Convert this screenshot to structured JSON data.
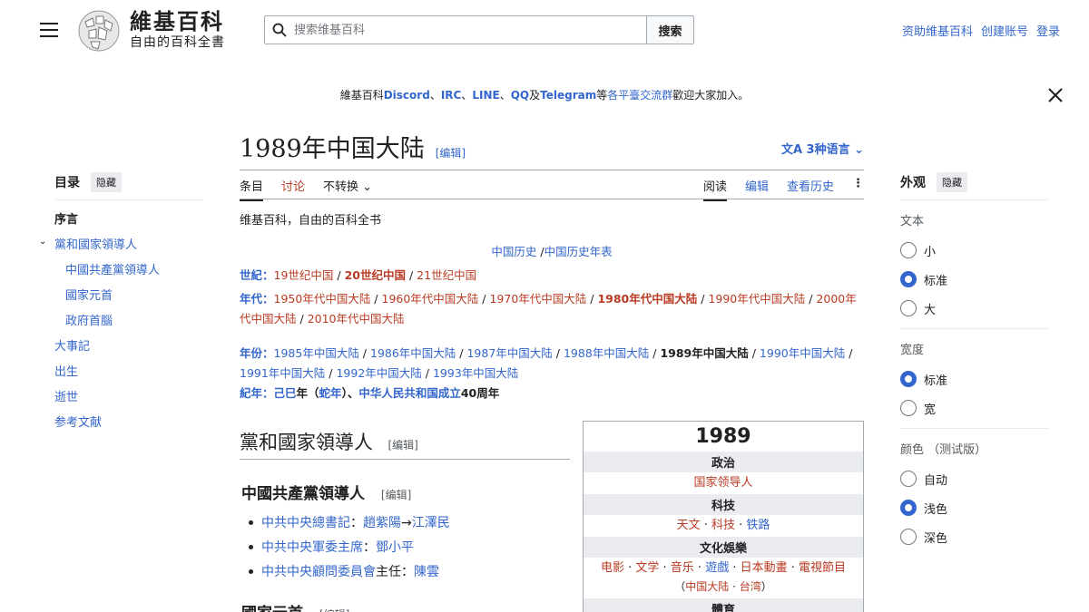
{
  "header": {
    "wordmark_title": "維基百科",
    "wordmark_tagline": "自由的百科全書",
    "search_placeholder": "搜索维基百科",
    "search_button": "搜索",
    "user_links": [
      "资助维基百科",
      "创建账号",
      "登录"
    ]
  },
  "banner": {
    "pre": "維基百科",
    "discord": "Discord",
    "sep1": "、",
    "irc": "IRC",
    "sep2": "、",
    "line": "LINE",
    "sep3": "、",
    "qq": "QQ",
    "and": "及",
    "telegram": "Telegram",
    "mid": "等",
    "platforms": "各平臺交流群",
    "post": "歡迎大家加入。"
  },
  "toc": {
    "title": "目录",
    "hide": "隐藏",
    "items": [
      {
        "label": "序言"
      },
      {
        "label": "黨和國家領導人"
      },
      {
        "label": "中國共產黨領導人"
      },
      {
        "label": "國家元首"
      },
      {
        "label": "政府首腦"
      },
      {
        "label": "大事記"
      },
      {
        "label": "出生"
      },
      {
        "label": "逝世"
      },
      {
        "label": "参考文献"
      }
    ]
  },
  "article": {
    "title": "1989年中国大陆",
    "edit": "[编辑]",
    "lang": "3种语言",
    "tabs_left": [
      "条目",
      "讨论",
      "不转换"
    ],
    "tabs_right": [
      "阅读",
      "编辑",
      "查看历史"
    ],
    "tagline": "维基百科，自由的百科全书",
    "nav_top": [
      "中国历史",
      " /",
      "中国历史年表"
    ],
    "century_label": "世紀：",
    "centuries": [
      "19世纪中国",
      "20世纪中国",
      "21世纪中国"
    ],
    "decade_label": "年代：",
    "decades": [
      "1950年代中国大陆",
      "1960年代中国大陆",
      "1970年代中国大陆",
      "1980年代中国大陆",
      "1990年代中国大陆",
      "2000年代中国大陆",
      "2010年代中国大陆"
    ],
    "year_label": "年份：",
    "years": [
      "1985年中国大陆",
      "1986年中国大陆",
      "1987年中国大陆",
      "1988年中国大陆",
      "1989年中国大陆",
      "1990年中国大陆",
      "1991年中国大陆",
      "1992年中国大陆",
      "1993年中国大陆"
    ],
    "jinian_label": "紀年：",
    "jinian": [
      "己巳",
      "年（",
      "蛇年",
      "）、",
      "中华人民共和国成立",
      "40周年"
    ],
    "h2": "黨和國家領導人",
    "h3": "中國共產黨領導人",
    "leaders": [
      {
        "role": "中共中央總書記",
        "sep": "：",
        "name1": "趙紫陽",
        "arrow": "→",
        "name2": "江澤民"
      },
      {
        "role": "中共中央軍委主席",
        "sep": "：",
        "name1": "鄧小平"
      },
      {
        "role": "中共中央顧問委員會",
        "mid": "主任",
        "sep": "：",
        "name1": "陳雲"
      }
    ],
    "h3b": "國家元首"
  },
  "infobox": {
    "year": "1989",
    "s1": "政治",
    "s1_items": [
      "国家领导人"
    ],
    "s2": "科技",
    "s2_items": [
      "天文",
      "科技",
      "铁路"
    ],
    "s3": "文化娛樂",
    "s3_items": [
      "电影",
      "文学",
      "音乐",
      "遊戲",
      "日本動畫",
      "電視節目"
    ],
    "s3_sub": [
      "中国大陆",
      "台湾"
    ],
    "s4": "體育"
  },
  "appearance": {
    "title": "外观",
    "hide": "隐藏",
    "text_label": "文本",
    "text_opts": [
      "小",
      "标准",
      "大"
    ],
    "width_label": "宽度",
    "width_opts": [
      "标准",
      "宽"
    ],
    "color_label": "颜色 （测试版）",
    "color_opts": [
      "自动",
      "浅色",
      "深色"
    ]
  }
}
